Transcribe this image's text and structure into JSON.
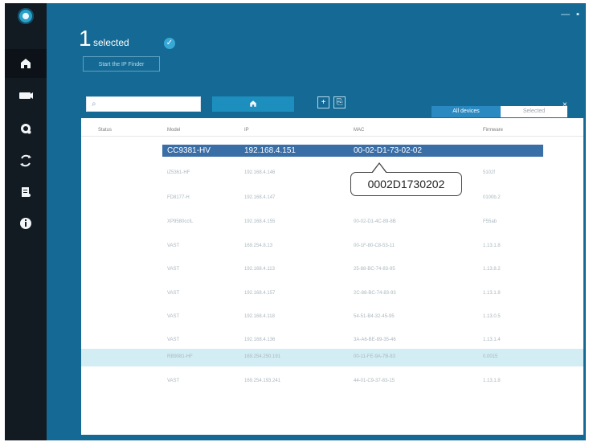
{
  "header": {
    "selected_count": "1",
    "selected_label": "selected",
    "start_button": "Start the IP Finder"
  },
  "sidebar": {
    "items": [
      {
        "name": "home",
        "icon": "home-icon"
      },
      {
        "name": "devices",
        "icon": "camera-icon"
      },
      {
        "name": "settings",
        "icon": "gear-icon"
      },
      {
        "name": "sync",
        "icon": "sync-icon"
      },
      {
        "name": "report",
        "icon": "report-icon"
      },
      {
        "name": "info",
        "icon": "info-icon"
      }
    ]
  },
  "toolbar": {
    "search_placeholder": "",
    "filter_all": "All devices",
    "filter_selected": "Selected"
  },
  "table": {
    "headers": {
      "status": "Status",
      "model": "Model",
      "ip": "IP",
      "mac": "MAC",
      "firmware": "Firmware"
    },
    "rows": [
      {
        "model": "CC9381-HV",
        "ip": "192.168.4.151",
        "mac": "00-02-D1-73-02-02",
        "firmware": ""
      },
      {
        "model": "iZ5361-HF",
        "ip": "192.168.4.146",
        "mac": "",
        "firmware": "5102f"
      },
      {
        "model": "FD8177-H",
        "ip": "192.168.4.147",
        "mac": "",
        "firmware": "0100b.2"
      },
      {
        "model": "XP9580ccIL",
        "ip": "192.168.4.155",
        "mac": "00-02-D1-4C-89-8B",
        "firmware": "F55ab"
      },
      {
        "model": "VAST",
        "ip": "169.254.8.13",
        "mac": "00-1F-80-C8-53-11",
        "firmware": "1.13.1.8"
      },
      {
        "model": "VAST",
        "ip": "192.168.4.113",
        "mac": "25-88-BC-74-83-95",
        "firmware": "1.13.8.2"
      },
      {
        "model": "VAST",
        "ip": "192.168.4.157",
        "mac": "2C-88-BC-74-83-93",
        "firmware": "1.13.1.8"
      },
      {
        "model": "VAST",
        "ip": "192.168.4.118",
        "mac": "54-51-B4-32-45-95",
        "firmware": "1.13.0.5"
      },
      {
        "model": "VAST",
        "ip": "192.168.4.136",
        "mac": "3A-A6-BE-89-35-46",
        "firmware": "1.13.1.4"
      },
      {
        "model": "RB9081-HF",
        "ip": "169.254.250.191",
        "mac": "00-11-FE-9A-7B-83",
        "firmware": "0.0015"
      },
      {
        "model": "VAST",
        "ip": "169.254.193.241",
        "mac": "44-01-C9-37-83-15",
        "firmware": "1.13.1.8"
      }
    ]
  },
  "tooltip": {
    "mac_compact": "0002D1730202"
  }
}
